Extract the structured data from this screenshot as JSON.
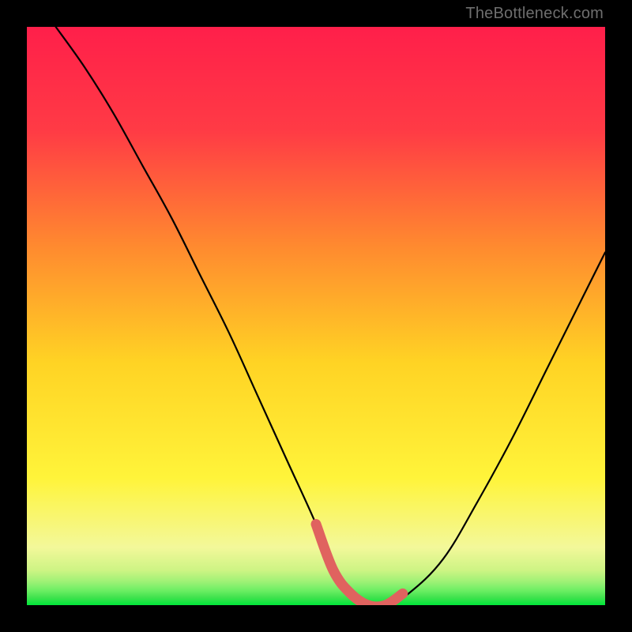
{
  "watermark": "TheBottleneck.com",
  "chart_data": {
    "type": "line",
    "title": "",
    "xlabel": "",
    "ylabel": "",
    "xlim": [
      0,
      100
    ],
    "ylim": [
      0,
      100
    ],
    "grid": false,
    "legend": false,
    "series": [
      {
        "name": "bottleneck-curve",
        "x": [
          5,
          10,
          15,
          20,
          25,
          30,
          35,
          40,
          45,
          50,
          53,
          56,
          59,
          62,
          66,
          72,
          78,
          84,
          90,
          96,
          100
        ],
        "values": [
          100,
          93,
          85,
          76,
          67,
          57,
          47,
          36,
          25,
          14,
          6,
          2,
          0,
          0,
          2,
          8,
          18,
          29,
          41,
          53,
          61
        ]
      }
    ],
    "highlight_segment": {
      "name": "floor-highlight",
      "x": [
        50,
        53,
        56,
        59,
        62,
        65
      ],
      "values": [
        14,
        6,
        2,
        0,
        0,
        2
      ]
    },
    "bands": [
      {
        "name": "green-strong",
        "color": "#00e73a",
        "from_y": 0,
        "to_y": 0.5
      },
      {
        "name": "green-mid",
        "color": "#4ff05e",
        "from_y": 0.5,
        "to_y": 1.5
      },
      {
        "name": "green-light",
        "color": "#9cf175",
        "from_y": 1.5,
        "to_y": 3
      },
      {
        "name": "yellow-pale",
        "color": "#f5f8a0",
        "from_y": 3,
        "to_y": 8
      },
      {
        "name": "yellow",
        "color": "#ffed33",
        "from_y": 8,
        "to_y": 40
      },
      {
        "name": "orange",
        "color": "#ff9f2e",
        "from_y": 40,
        "to_y": 65
      },
      {
        "name": "red-orange",
        "color": "#ff5a3a",
        "from_y": 65,
        "to_y": 85
      },
      {
        "name": "red",
        "color": "#ff1f4a",
        "from_y": 85,
        "to_y": 100
      }
    ]
  }
}
